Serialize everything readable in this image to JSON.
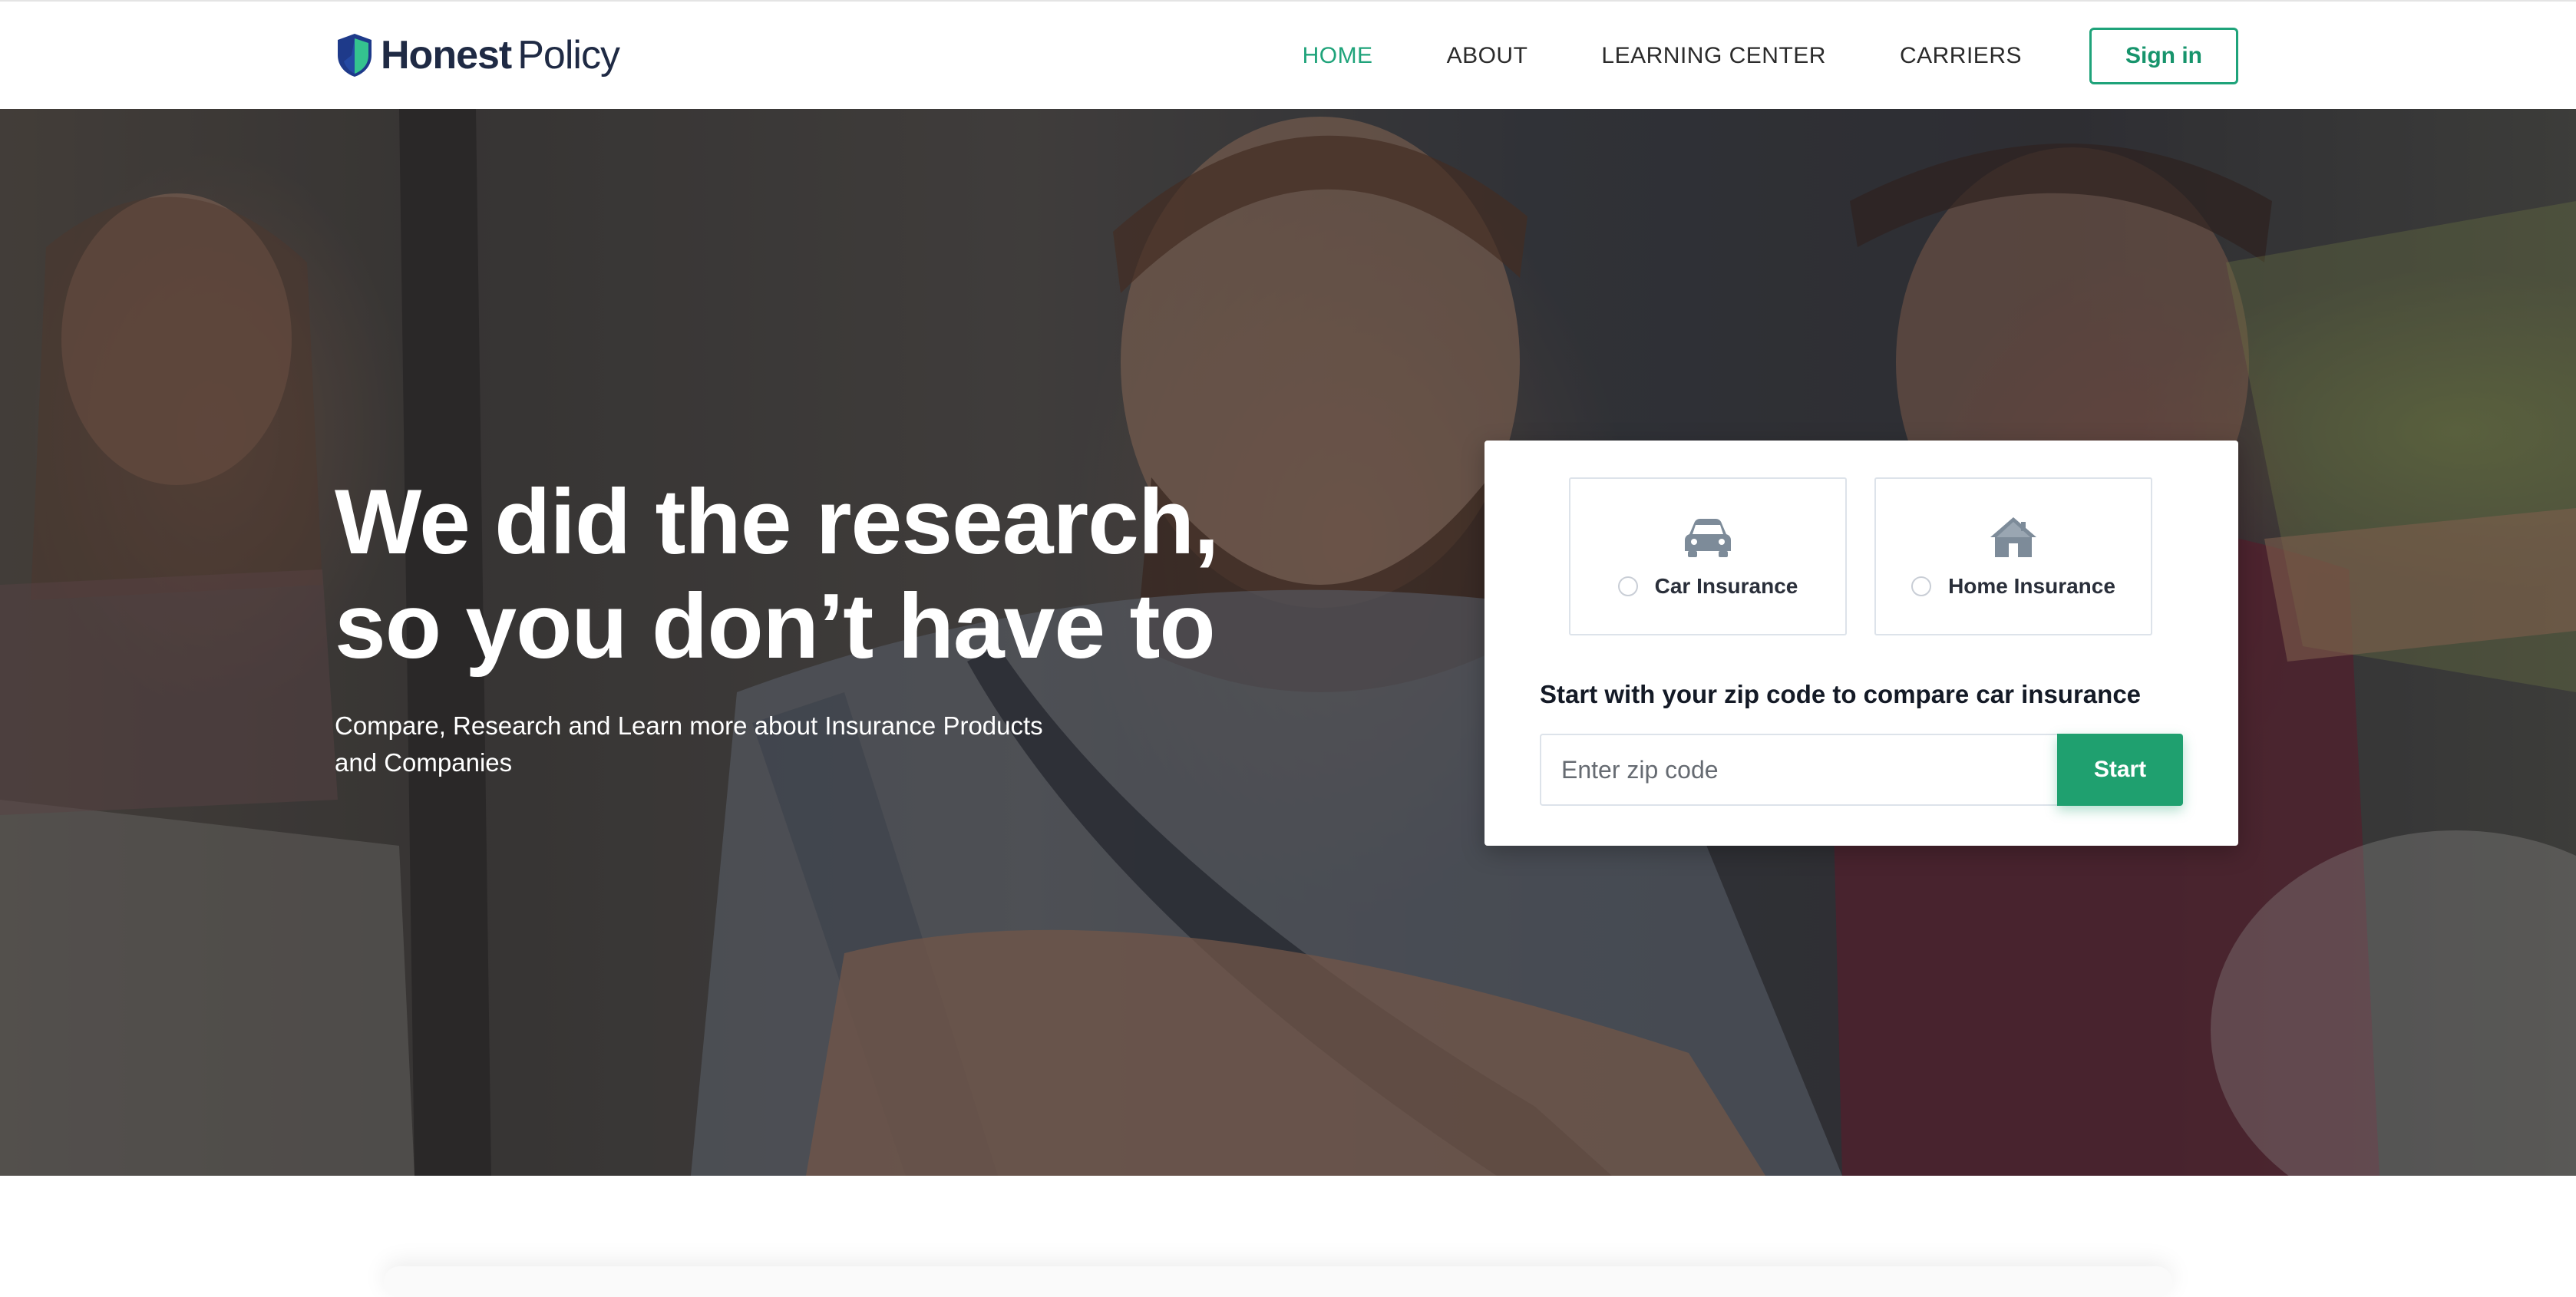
{
  "header": {
    "logo": {
      "brand_strong": "Honest",
      "brand_light": "Policy",
      "icon": "shield-icon"
    },
    "nav": [
      {
        "label": "HOME",
        "active": true
      },
      {
        "label": "ABOUT",
        "active": false
      },
      {
        "label": "LEARNING CENTER",
        "active": false
      },
      {
        "label": "CARRIERS",
        "active": false
      }
    ],
    "signin_label": "Sign in"
  },
  "hero": {
    "title_line1": "We did the research,",
    "title_line2": "so you don’t have to",
    "subtitle_line1": "Compare, Research and Learn more about Insurance Products",
    "subtitle_line2": "and Companies"
  },
  "quote_card": {
    "options": [
      {
        "label": "Car Insurance",
        "icon": "car-icon",
        "selected": false
      },
      {
        "label": "Home Insurance",
        "icon": "house-icon",
        "selected": false
      }
    ],
    "zip_heading": "Start with your zip code to compare car insurance",
    "zip_placeholder": "Enter zip code",
    "zip_value": "",
    "start_label": "Start"
  },
  "colors": {
    "accent": "#1fa37a",
    "button": "#1fa06f",
    "text_dark": "#1f2a44",
    "shield_dark": "#1e3a8a",
    "shield_light": "#34c38f"
  }
}
